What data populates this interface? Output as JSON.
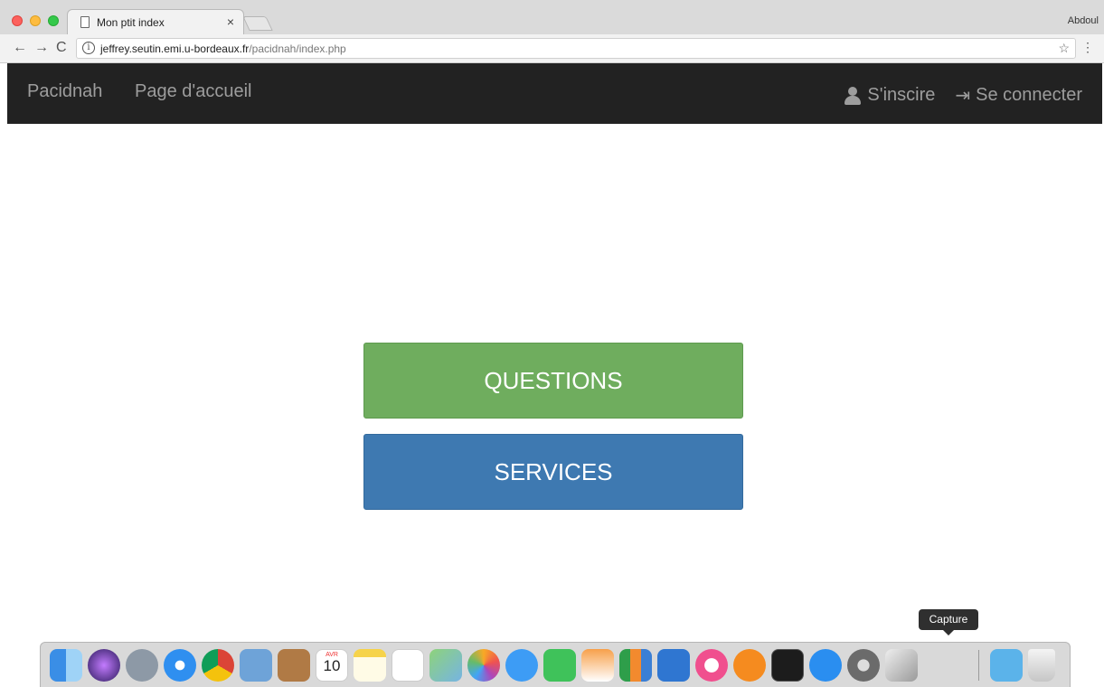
{
  "browser": {
    "tab_title": "Mon ptit index",
    "tab_close": "×",
    "user": "Abdoul",
    "url_host": "jeffrey.seutin.emi.u-bordeaux.fr",
    "url_path": "/pacidnah/index.php",
    "back": "←",
    "forward": "→",
    "reload": "C",
    "info": "i",
    "star": "☆",
    "menu": "⋮"
  },
  "navbar": {
    "brand": "Pacidnah",
    "home": "Page d'accueil",
    "signup": "S'inscire",
    "login": "Se connecter",
    "login_icon": "⇥"
  },
  "buttons": {
    "questions": "QUESTIONS",
    "services": "SERVICES"
  },
  "tooltip": "Capture",
  "dock": {
    "calendar_month": "AVR",
    "calendar_day": "10",
    "items": [
      "finder-icon",
      "siri-icon",
      "launchpad-icon",
      "safari-icon",
      "chrome-icon",
      "mail-icon",
      "contacts-icon",
      "calendar-icon",
      "notes-icon",
      "reminders-icon",
      "maps-icon",
      "photos-icon",
      "messages-icon",
      "facetime-icon",
      "pages-icon",
      "numbers-icon",
      "keynote-icon",
      "itunes-icon",
      "ibooks-icon",
      "terminal-icon",
      "app-store-icon",
      "system-preferences-icon",
      "capture-icon",
      "downloads-folder-icon",
      "trash-icon"
    ]
  },
  "colors": {
    "questions": "#6fad5e",
    "services": "#3e79b1",
    "navbar": "#222222"
  }
}
